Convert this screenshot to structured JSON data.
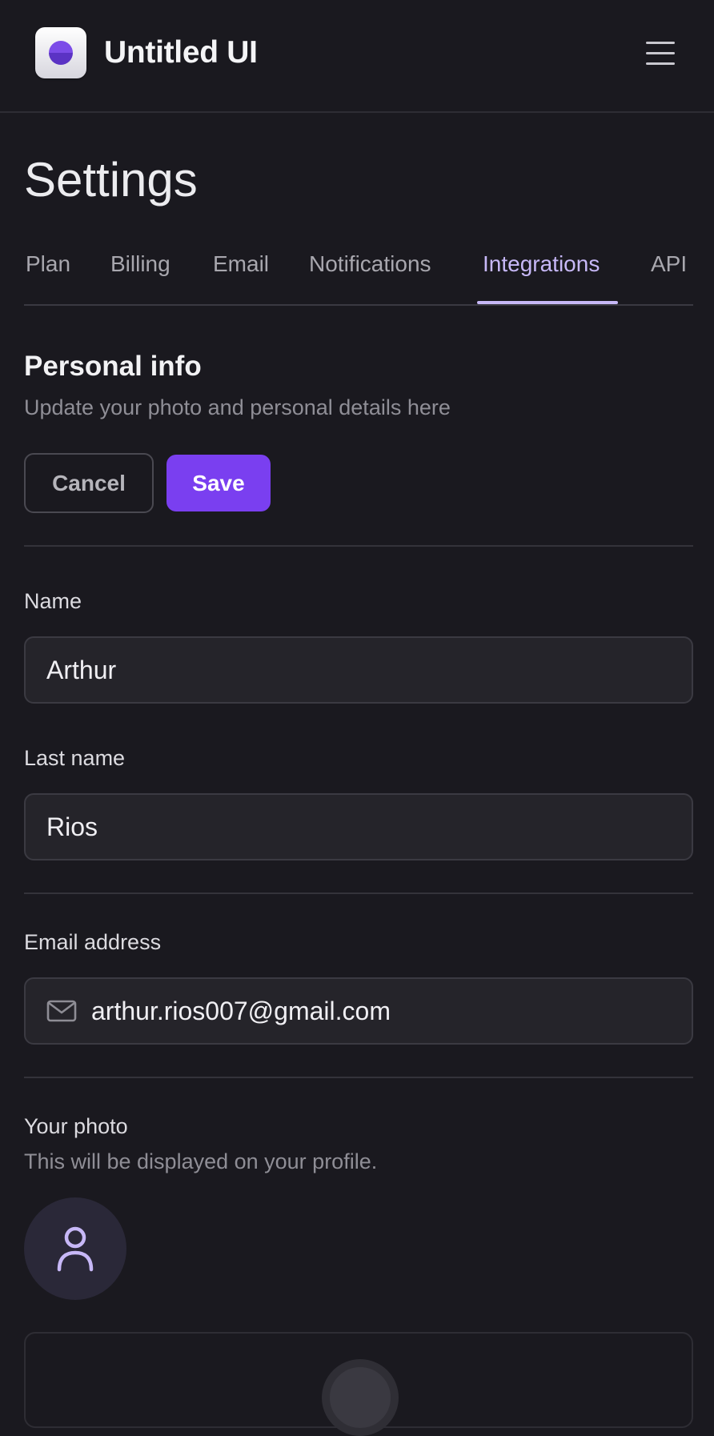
{
  "app": {
    "title": "Untitled UI"
  },
  "page": {
    "title": "Settings"
  },
  "tabs": [
    {
      "label": "Plan",
      "active": false
    },
    {
      "label": "Billing",
      "active": false
    },
    {
      "label": "Email",
      "active": false
    },
    {
      "label": "Notifications",
      "active": false
    },
    {
      "label": "Integrations",
      "active": true
    },
    {
      "label": "API",
      "active": false
    }
  ],
  "personal_info": {
    "title": "Personal info",
    "subtitle": "Update your photo and personal details here",
    "cancel_label": "Cancel",
    "save_label": "Save"
  },
  "form": {
    "name": {
      "label": "Name",
      "value": "Arthur"
    },
    "last_name": {
      "label": "Last name",
      "value": "Rios"
    },
    "email": {
      "label": "Email address",
      "value": "arthur.rios007@gmail.com",
      "icon": "mail-icon"
    },
    "photo": {
      "label": "Your photo",
      "subtitle": "This will be displayed on your profile.",
      "avatar_icon": "user-icon"
    }
  },
  "colors": {
    "accent": "#7a3ff0",
    "active_tab": "#c7b8f7",
    "background": "#1a191f"
  }
}
